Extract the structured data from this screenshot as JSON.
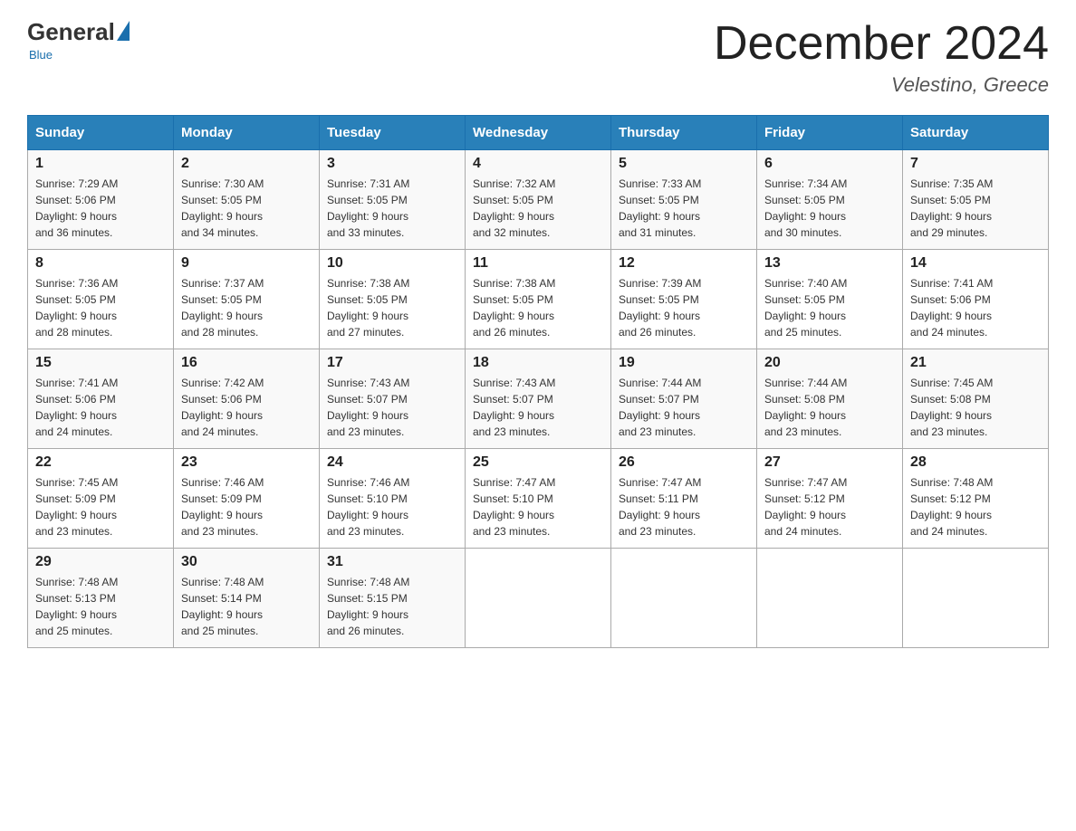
{
  "logo": {
    "general": "General",
    "blue": "Blue",
    "tagline": "Blue"
  },
  "header": {
    "month_title": "December 2024",
    "location": "Velestino, Greece"
  },
  "days_of_week": [
    "Sunday",
    "Monday",
    "Tuesday",
    "Wednesday",
    "Thursday",
    "Friday",
    "Saturday"
  ],
  "weeks": [
    [
      {
        "day": "1",
        "sunrise": "7:29 AM",
        "sunset": "5:06 PM",
        "daylight": "9 hours and 36 minutes."
      },
      {
        "day": "2",
        "sunrise": "7:30 AM",
        "sunset": "5:05 PM",
        "daylight": "9 hours and 34 minutes."
      },
      {
        "day": "3",
        "sunrise": "7:31 AM",
        "sunset": "5:05 PM",
        "daylight": "9 hours and 33 minutes."
      },
      {
        "day": "4",
        "sunrise": "7:32 AM",
        "sunset": "5:05 PM",
        "daylight": "9 hours and 32 minutes."
      },
      {
        "day": "5",
        "sunrise": "7:33 AM",
        "sunset": "5:05 PM",
        "daylight": "9 hours and 31 minutes."
      },
      {
        "day": "6",
        "sunrise": "7:34 AM",
        "sunset": "5:05 PM",
        "daylight": "9 hours and 30 minutes."
      },
      {
        "day": "7",
        "sunrise": "7:35 AM",
        "sunset": "5:05 PM",
        "daylight": "9 hours and 29 minutes."
      }
    ],
    [
      {
        "day": "8",
        "sunrise": "7:36 AM",
        "sunset": "5:05 PM",
        "daylight": "9 hours and 28 minutes."
      },
      {
        "day": "9",
        "sunrise": "7:37 AM",
        "sunset": "5:05 PM",
        "daylight": "9 hours and 28 minutes."
      },
      {
        "day": "10",
        "sunrise": "7:38 AM",
        "sunset": "5:05 PM",
        "daylight": "9 hours and 27 minutes."
      },
      {
        "day": "11",
        "sunrise": "7:38 AM",
        "sunset": "5:05 PM",
        "daylight": "9 hours and 26 minutes."
      },
      {
        "day": "12",
        "sunrise": "7:39 AM",
        "sunset": "5:05 PM",
        "daylight": "9 hours and 26 minutes."
      },
      {
        "day": "13",
        "sunrise": "7:40 AM",
        "sunset": "5:05 PM",
        "daylight": "9 hours and 25 minutes."
      },
      {
        "day": "14",
        "sunrise": "7:41 AM",
        "sunset": "5:06 PM",
        "daylight": "9 hours and 24 minutes."
      }
    ],
    [
      {
        "day": "15",
        "sunrise": "7:41 AM",
        "sunset": "5:06 PM",
        "daylight": "9 hours and 24 minutes."
      },
      {
        "day": "16",
        "sunrise": "7:42 AM",
        "sunset": "5:06 PM",
        "daylight": "9 hours and 24 minutes."
      },
      {
        "day": "17",
        "sunrise": "7:43 AM",
        "sunset": "5:07 PM",
        "daylight": "9 hours and 23 minutes."
      },
      {
        "day": "18",
        "sunrise": "7:43 AM",
        "sunset": "5:07 PM",
        "daylight": "9 hours and 23 minutes."
      },
      {
        "day": "19",
        "sunrise": "7:44 AM",
        "sunset": "5:07 PM",
        "daylight": "9 hours and 23 minutes."
      },
      {
        "day": "20",
        "sunrise": "7:44 AM",
        "sunset": "5:08 PM",
        "daylight": "9 hours and 23 minutes."
      },
      {
        "day": "21",
        "sunrise": "7:45 AM",
        "sunset": "5:08 PM",
        "daylight": "9 hours and 23 minutes."
      }
    ],
    [
      {
        "day": "22",
        "sunrise": "7:45 AM",
        "sunset": "5:09 PM",
        "daylight": "9 hours and 23 minutes."
      },
      {
        "day": "23",
        "sunrise": "7:46 AM",
        "sunset": "5:09 PM",
        "daylight": "9 hours and 23 minutes."
      },
      {
        "day": "24",
        "sunrise": "7:46 AM",
        "sunset": "5:10 PM",
        "daylight": "9 hours and 23 minutes."
      },
      {
        "day": "25",
        "sunrise": "7:47 AM",
        "sunset": "5:10 PM",
        "daylight": "9 hours and 23 minutes."
      },
      {
        "day": "26",
        "sunrise": "7:47 AM",
        "sunset": "5:11 PM",
        "daylight": "9 hours and 23 minutes."
      },
      {
        "day": "27",
        "sunrise": "7:47 AM",
        "sunset": "5:12 PM",
        "daylight": "9 hours and 24 minutes."
      },
      {
        "day": "28",
        "sunrise": "7:48 AM",
        "sunset": "5:12 PM",
        "daylight": "9 hours and 24 minutes."
      }
    ],
    [
      {
        "day": "29",
        "sunrise": "7:48 AM",
        "sunset": "5:13 PM",
        "daylight": "9 hours and 25 minutes."
      },
      {
        "day": "30",
        "sunrise": "7:48 AM",
        "sunset": "5:14 PM",
        "daylight": "9 hours and 25 minutes."
      },
      {
        "day": "31",
        "sunrise": "7:48 AM",
        "sunset": "5:15 PM",
        "daylight": "9 hours and 26 minutes."
      },
      null,
      null,
      null,
      null
    ]
  ],
  "labels": {
    "sunrise": "Sunrise:",
    "sunset": "Sunset:",
    "daylight": "Daylight:"
  }
}
